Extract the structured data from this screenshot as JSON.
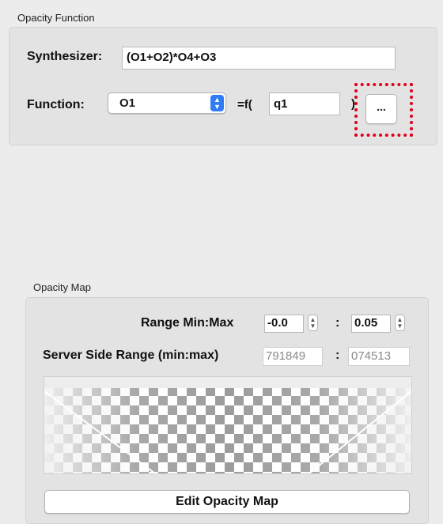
{
  "opacity_function": {
    "section_title": "Opacity Function",
    "synthesizer_label": "Synthesizer:",
    "synthesizer_value": "(O1+O2)*O4+O3",
    "function_label": "Function:",
    "function_selected": "O1",
    "equals_f_label": "=f(",
    "argument_value": "q1",
    "close_paren": ")",
    "more_button_label": "..."
  },
  "opacity_map": {
    "section_title": "Opacity Map",
    "range_label": "Range Min:Max",
    "range_min": "-0.0",
    "range_separator": ":",
    "range_max": "0.05",
    "server_range_label": "Server Side Range (min:max)",
    "server_min": "791849",
    "server_separator": ":",
    "server_max": "074513",
    "edit_button_label": "Edit Opacity Map"
  },
  "colors": {
    "accent_blue": "#2f7cf6",
    "highlight_red": "#e0001b"
  }
}
